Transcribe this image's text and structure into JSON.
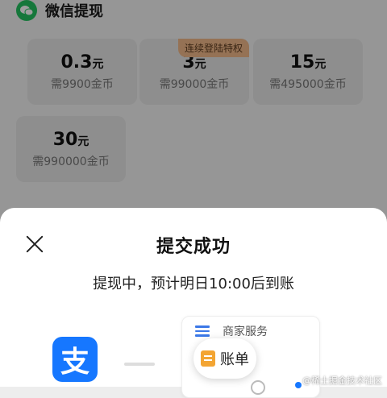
{
  "header": {
    "title": "微信提现",
    "icon": "wechat-icon"
  },
  "cards": [
    {
      "amount": "0.3",
      "unit": "元",
      "cost": "需9900金币"
    },
    {
      "amount": "3",
      "unit": "元",
      "cost": "需99000金币",
      "badge": "连续登陆特权"
    },
    {
      "amount": "15",
      "unit": "元",
      "cost": "需495000金币"
    },
    {
      "amount": "30",
      "unit": "元",
      "cost": "需990000金币"
    }
  ],
  "sheet": {
    "title": "提交成功",
    "message": "提现中，预计明日10:00后到账",
    "preview": {
      "merchant": "商家服务",
      "bill": "账单"
    },
    "alipay_glyph": "支"
  },
  "watermark": "@稀土掘金技术社区",
  "colors": {
    "wechat_green": "#24c15f",
    "alipay_blue": "#1677ff",
    "badge_bg": "#f0b889"
  }
}
